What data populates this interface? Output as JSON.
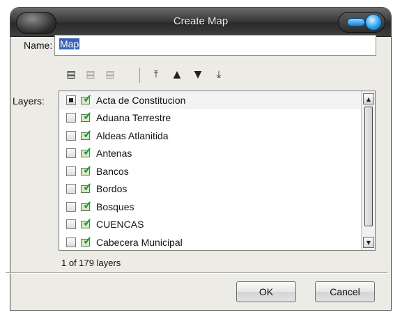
{
  "window": {
    "title": "Create Map"
  },
  "form": {
    "name_label": "Name:",
    "name_value": "Map",
    "layers_label": "Layers:"
  },
  "toolbar": {
    "icons": [
      "add-layer-icon",
      "remove-layer-icon",
      "edit-layer-icon",
      "move-top-icon",
      "move-up-icon",
      "move-down-icon",
      "move-bottom-icon"
    ]
  },
  "layers": {
    "items": [
      {
        "label": "Acta de Constitucion",
        "checked": true,
        "selected": true
      },
      {
        "label": "Aduana Terrestre",
        "checked": false,
        "selected": false
      },
      {
        "label": "Aldeas Atlanitida",
        "checked": false,
        "selected": false
      },
      {
        "label": "Antenas",
        "checked": false,
        "selected": false
      },
      {
        "label": "Bancos",
        "checked": false,
        "selected": false
      },
      {
        "label": "Bordos",
        "checked": false,
        "selected": false
      },
      {
        "label": "Bosques",
        "checked": false,
        "selected": false
      },
      {
        "label": "CUENCAS",
        "checked": false,
        "selected": false
      },
      {
        "label": "Cabecera Municipal",
        "checked": false,
        "selected": false
      }
    ],
    "count_text": "1 of 179 layers"
  },
  "buttons": {
    "ok_label": "OK",
    "cancel_label": "Cancel"
  }
}
